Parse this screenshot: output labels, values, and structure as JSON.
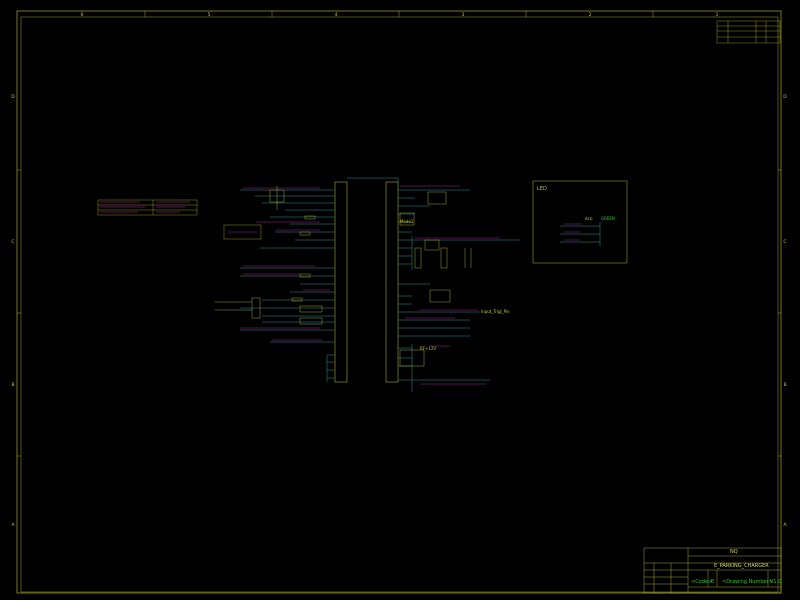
{
  "sheet": {
    "column_labels": [
      "6",
      "5",
      "4",
      "3",
      "2",
      "1"
    ],
    "row_labels": [
      "D",
      "C",
      "B",
      "A"
    ],
    "colors": {
      "background": "#000000",
      "frame": "#c8c832",
      "wire": "#1e9696",
      "magenta": "#b428b4",
      "component": "#c8c832",
      "accent_green": "#28c828"
    }
  },
  "schematic": {
    "nets": {
      "net_a": "Mode1",
      "net_b": "GREEN",
      "net_c": "Input_Trigl_Pin",
      "net_d": "RF+12V",
      "led_group": "LED",
      "red_label": "RED"
    }
  },
  "title_block": {
    "company": "NQ",
    "project": "E_PARKING_CHARGER",
    "code": "<Code>",
    "size": "E",
    "drawing_number": "<Drawing Number>",
    "revision": "V1.0"
  }
}
